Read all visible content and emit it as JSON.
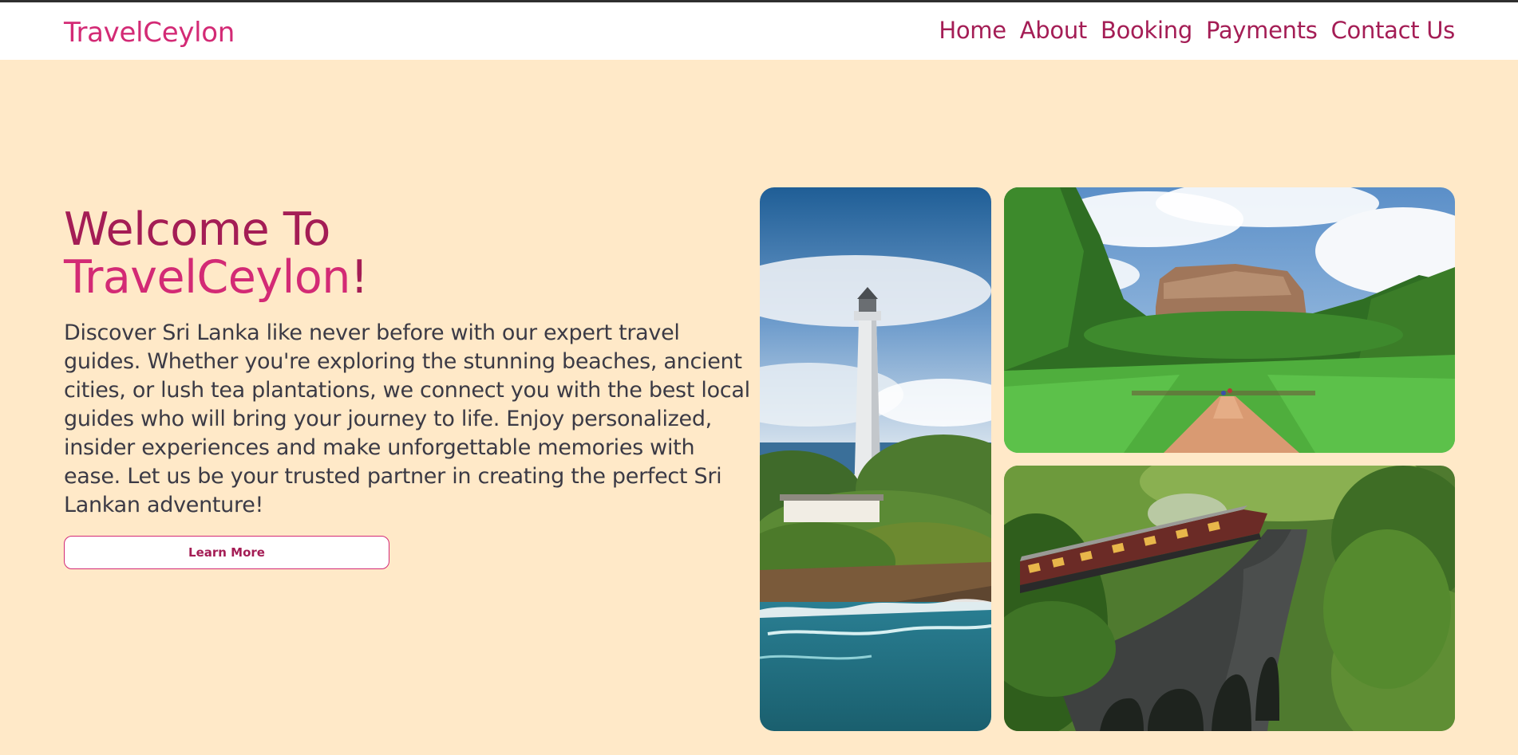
{
  "header": {
    "logo": "TravelCeylon",
    "nav": [
      "Home",
      "About",
      "Booking",
      "Payments",
      "Contact Us"
    ]
  },
  "hero": {
    "headline_line1": "Welcome To",
    "headline_line2": "TravelCeylon",
    "headline_punct": "!",
    "description": "Discover Sri Lanka like never before with our expert travel guides. Whether you're exploring the stunning beaches, ancient cities, or lush tea plantations, we connect you with the best local guides who will bring your journey to life. Enjoy personalized, insider experiences and make unforgettable memories with ease. Let us be your trusted partner in creating the perfect Sri Lankan adventure!",
    "cta_label": "Learn More"
  },
  "gallery": [
    {
      "subject": "lighthouse-coast"
    },
    {
      "subject": "sigiriya-rock"
    },
    {
      "subject": "nine-arch-bridge-train"
    }
  ],
  "colors": {
    "background": "#ffe9c8",
    "brand": "#d32a75",
    "brand_dark": "#a41d55",
    "text": "#3b3a45"
  }
}
